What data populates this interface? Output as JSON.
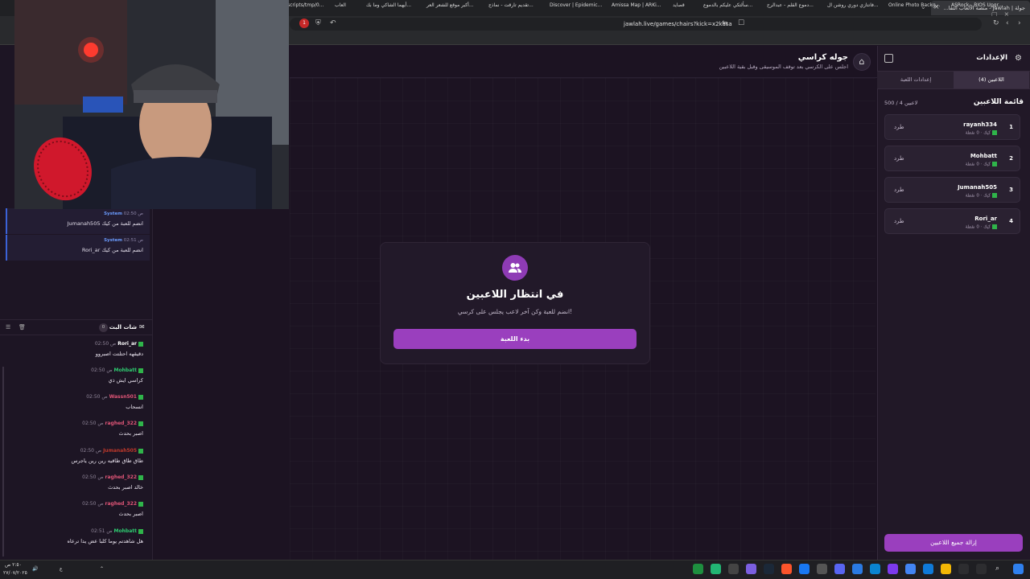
{
  "browser": {
    "tab_title": "جولة | Jawlah - منصة الألعاب التفا...",
    "url": "jawlah.live/games/chairs?kick=x2kasa",
    "bookmarks": [
      "ASRock - BIOS Upgr...",
      "Online Photo Backg...",
      "فانتازي دوري روشن ال...",
      "دموع القلم - عبدالرح...",
      "سألتكي عليكم بالدموع...",
      "قصايد",
      "Amissa Map | ARKi...",
      "Discover | Epidemic...",
      "تقديم تارقت - نماذج...",
      "أكبر موقع للشعر العر...",
      "أيهما الشاكي وما بك...",
      "العاب",
      "scripts/tmp/0..."
    ],
    "badge_count": "1"
  },
  "header": {
    "title": "جوله كراسي",
    "subtitle": "اجلس على الكرسي بعد توقف الموسيقى وقبل بقية اللاعبين"
  },
  "waiting": {
    "title": "في انتظار اللاعبين",
    "subtitle": "انضم للعبة وكن آخر لاعب يجلس على كرسي!",
    "start_label": "بدء اللعبة"
  },
  "settings": {
    "title": "الإعدادات",
    "tabs": [
      "اللاعبين (4)",
      "إعدادات اللعبة"
    ],
    "list_title": "قائمة اللاعبين",
    "count_label": "500 / 4 لاعبين",
    "players": [
      {
        "num": "1",
        "name": "rayanh334",
        "meta": "كيك · 0 نقطة",
        "kick": "طرد"
      },
      {
        "num": "2",
        "name": "Mohbatt",
        "meta": "كيك · 0 نقطة",
        "kick": "طرد"
      },
      {
        "num": "3",
        "name": "Jumanah505",
        "meta": "كيك · 0 نقطة",
        "kick": "طرد"
      },
      {
        "num": "4",
        "name": "Rori_ar",
        "meta": "كيك · 0 نقطة",
        "kick": "طرد"
      }
    ],
    "clear_label": "إزالة جميع اللاعبين"
  },
  "system_messages": [
    {
      "sender": "System",
      "time": "02:50 ص",
      "text": "Jumanah505 انضم للعبة من كيك"
    },
    {
      "sender": "System",
      "time": "02:51 ص",
      "text": "Rori_ar انضم للعبة من كيك"
    }
  ],
  "chat": {
    "title": "شات البث",
    "count": "0",
    "messages": [
      {
        "user": "Rori_ar",
        "color": "#ffffff",
        "time": "02:50 ص",
        "text": "دقيقهه احتلتت اصبروو"
      },
      {
        "user": "Mohbatt",
        "color": "#2ecc71",
        "time": "02:50 ص",
        "text": "كراسي ايش ذي"
      },
      {
        "user": "Wassn501",
        "color": "#e05577",
        "time": "02:50 ص",
        "text": "انسحاب"
      },
      {
        "user": "raghed_322",
        "color": "#e05577",
        "time": "02:50 ص",
        "text": "اصبر بحدث"
      },
      {
        "user": "Jumanah505",
        "color": "#c0392b",
        "time": "02:50 ص",
        "text": "طاق طاق طاقيه رين رين ياجرس"
      },
      {
        "user": "raghed_322",
        "color": "#e05577",
        "time": "02:50 ص",
        "text": "خالد اصبر بحدث"
      },
      {
        "user": "raghed_322",
        "color": "#e05577",
        "time": "02:50 ص",
        "text": "اصبر بحدث"
      },
      {
        "user": "Mohbatt",
        "color": "#2ecc71",
        "time": "02:51 ص",
        "text": "هل شاهدتم يوما كلبا عض يدا ترعاه"
      }
    ]
  },
  "taskbar": {
    "time": "٢:٥٠ ص",
    "date": "٢٧/٠٧/٢٠٢٥",
    "lang": "ع"
  },
  "colors": {
    "accent": "#9a3fbe",
    "background": "#1c1322",
    "panel": "#211827"
  }
}
